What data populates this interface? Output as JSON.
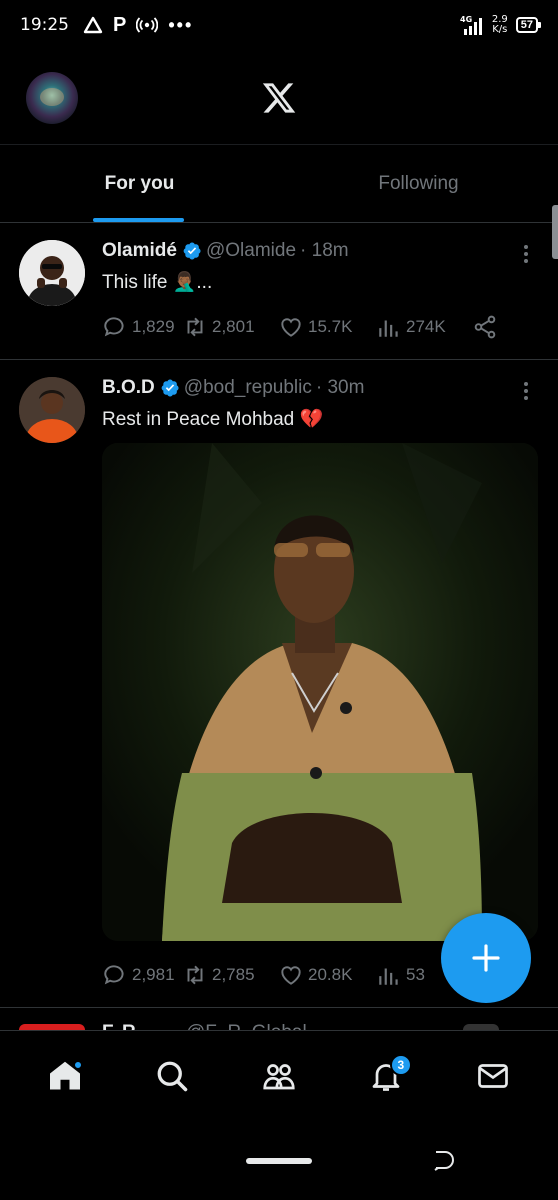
{
  "status_bar": {
    "time": "19:25",
    "p_icon": "P",
    "dots": "•••",
    "network": "4G",
    "speed_value": "2.9",
    "speed_unit": "K/s",
    "battery": "57"
  },
  "header": {
    "logo": "x-logo"
  },
  "tabs": [
    {
      "label": "For you",
      "active": true
    },
    {
      "label": "Following",
      "active": false
    }
  ],
  "posts": [
    {
      "name": "Olamidé",
      "handle": "@Olamide",
      "time": "· 18m",
      "text": "This life 🤦🏾‍♂️...",
      "replies": "1,829",
      "reposts": "2,801",
      "likes": "15.7K",
      "views": "274K"
    },
    {
      "name": "B.O.D",
      "handle": "@bod_republic",
      "time": "· 30m",
      "text": "Rest in Peace Mohbad 💔",
      "replies": "2,981",
      "reposts": "2,785",
      "likes": "20.8K",
      "views": "53"
    }
  ],
  "peek_post": {
    "name": "F. R",
    "handle": "@F_R_Global"
  },
  "bottom_nav": {
    "notifications_badge": "3"
  },
  "colors": {
    "accent": "#1d9bf0",
    "background": "#000000",
    "muted": "#71767b",
    "text": "#e7e9ea",
    "divider": "#2f3336"
  }
}
